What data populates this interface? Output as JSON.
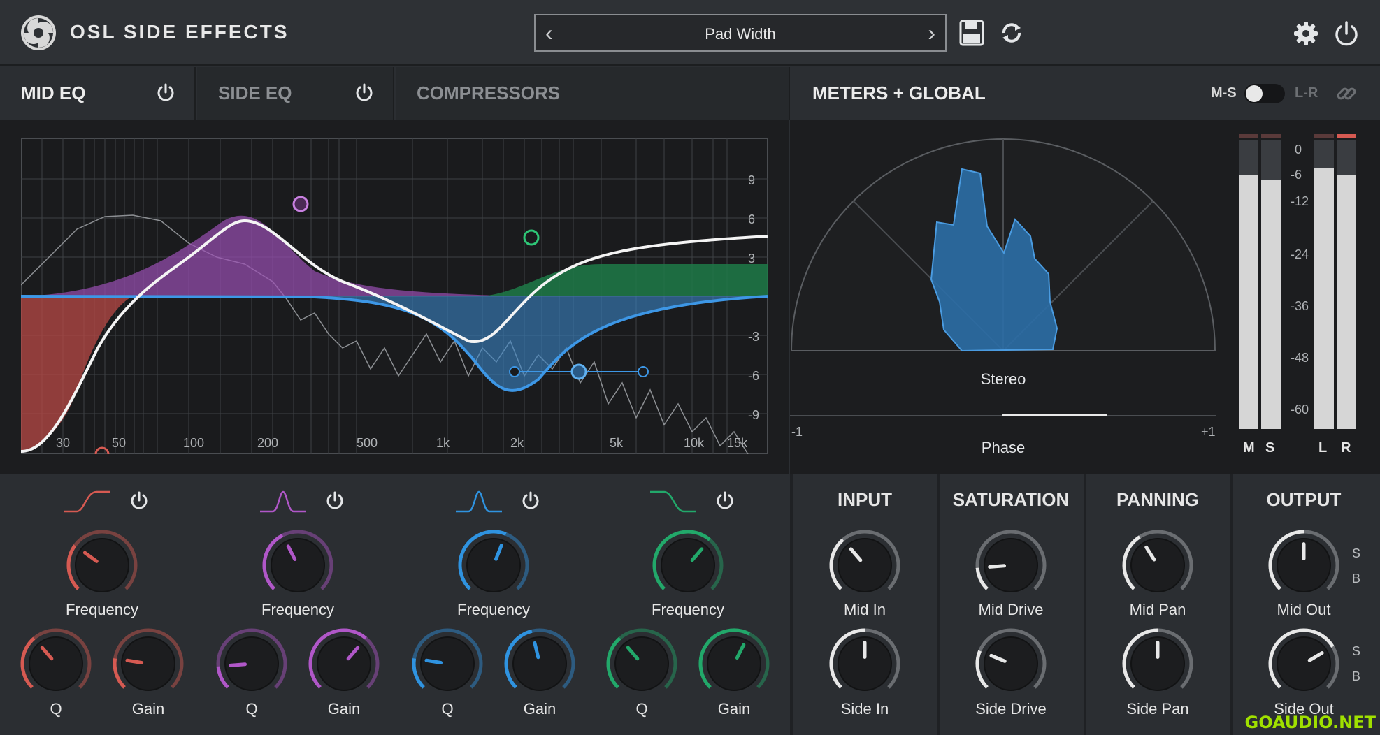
{
  "header": {
    "brand": "OSL SIDE EFFECTS",
    "preset_name": "Pad Width",
    "prev_glyph": "‹",
    "next_glyph": "›"
  },
  "tabs": [
    {
      "label": "MID EQ",
      "has_power": true
    },
    {
      "label": "SIDE EQ",
      "has_power": true
    },
    {
      "label": "COMPRESSORS",
      "has_power": false
    },
    {
      "label": "METERS + GLOBAL",
      "has_power": false
    }
  ],
  "mode_toggle": {
    "left": "M-S",
    "right": "L-R"
  },
  "eq": {
    "db_ticks": [
      "9",
      "6",
      "3",
      "-3",
      "-6",
      "-9"
    ],
    "freq_ticks": [
      "30",
      "50",
      "100",
      "200",
      "500",
      "1k",
      "2k",
      "5k",
      "10k",
      "15k"
    ],
    "colors": {
      "low": "#c0504d",
      "bell1": "#a858c0",
      "bell2": "#3d8fd0",
      "high": "#2e9a5e"
    }
  },
  "meters": {
    "stereo_label": "Stereo",
    "phase_label": "Phase",
    "phase_min": "-1",
    "phase_max": "+1",
    "scale": [
      "0",
      "-6",
      "-12",
      "-24",
      "-36",
      "-48",
      "-60"
    ],
    "channels": [
      "M",
      "S",
      "L",
      "R"
    ],
    "levels": {
      "M": 0.88,
      "S": 0.86,
      "L": 0.9,
      "R": 0.88
    }
  },
  "bands": [
    {
      "color": "#d65a52",
      "icon": "low-cut-icon",
      "freq_label": "Frequency",
      "q_label": "Q",
      "gain_label": "Gain",
      "freq": 0.3,
      "q": 0.35,
      "gain": 0.2
    },
    {
      "color": "#b057c8",
      "icon": "bell-icon",
      "freq_label": "Frequency",
      "q_label": "Q",
      "gain_label": "Gain",
      "freq": 0.4,
      "q": 0.15,
      "gain": 0.65
    },
    {
      "color": "#2f93e0",
      "icon": "bell-icon",
      "freq_label": "Frequency",
      "q_label": "Q",
      "gain_label": "Gain",
      "freq": 0.58,
      "q": 0.2,
      "gain": 0.45
    },
    {
      "color": "#22a86a",
      "icon": "high-shelf-icon",
      "freq_label": "Frequency",
      "q_label": "Q",
      "gain_label": "Gain",
      "freq": 0.65,
      "q": 0.35,
      "gain": 0.6
    }
  ],
  "global": [
    {
      "title": "INPUT",
      "top_label": "Mid In",
      "bottom_label": "Side In",
      "top": 0.35,
      "bottom": 0.5
    },
    {
      "title": "SATURATION",
      "top_label": "Mid Drive",
      "bottom_label": "Side Drive",
      "top": 0.15,
      "bottom": 0.25
    },
    {
      "title": "PANNING",
      "top_label": "Mid Pan",
      "bottom_label": "Side Pan",
      "top": 0.38,
      "bottom": 0.5
    },
    {
      "title": "OUTPUT",
      "top_label": "Mid Out",
      "bottom_label": "Side Out",
      "top": 0.5,
      "bottom": 0.72,
      "sb": [
        "S",
        "B"
      ]
    }
  ],
  "watermark": "GOAUDIO.NET"
}
